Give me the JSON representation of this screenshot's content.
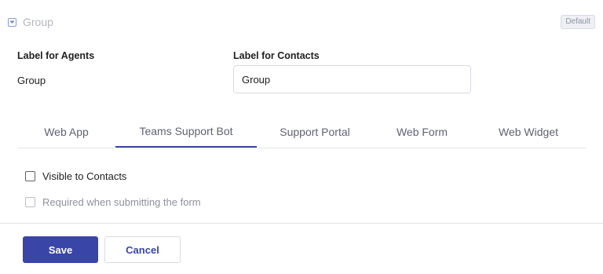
{
  "field": {
    "title": "Group",
    "badge": "Default",
    "icon": "dropdown-icon"
  },
  "labels": {
    "agents_title": "Label for Agents",
    "agents_value": "Group",
    "contacts_title": "Label for Contacts",
    "contacts_value": "Group"
  },
  "tabs": [
    {
      "label": "Web App",
      "active": false
    },
    {
      "label": "Teams Support Bot",
      "active": true
    },
    {
      "label": "Support Portal",
      "active": false
    },
    {
      "label": "Web Form",
      "active": false
    },
    {
      "label": "Web Widget",
      "active": false
    }
  ],
  "options": {
    "visible_label": "Visible to Contacts",
    "visible_checked": false,
    "required_label": "Required when submitting the form",
    "required_checked": false,
    "required_disabled": true
  },
  "footer": {
    "save_label": "Save",
    "cancel_label": "Cancel"
  },
  "colors": {
    "accent": "#3a45a8",
    "muted_text": "#b3b7c0",
    "border": "#d7dbe3"
  }
}
